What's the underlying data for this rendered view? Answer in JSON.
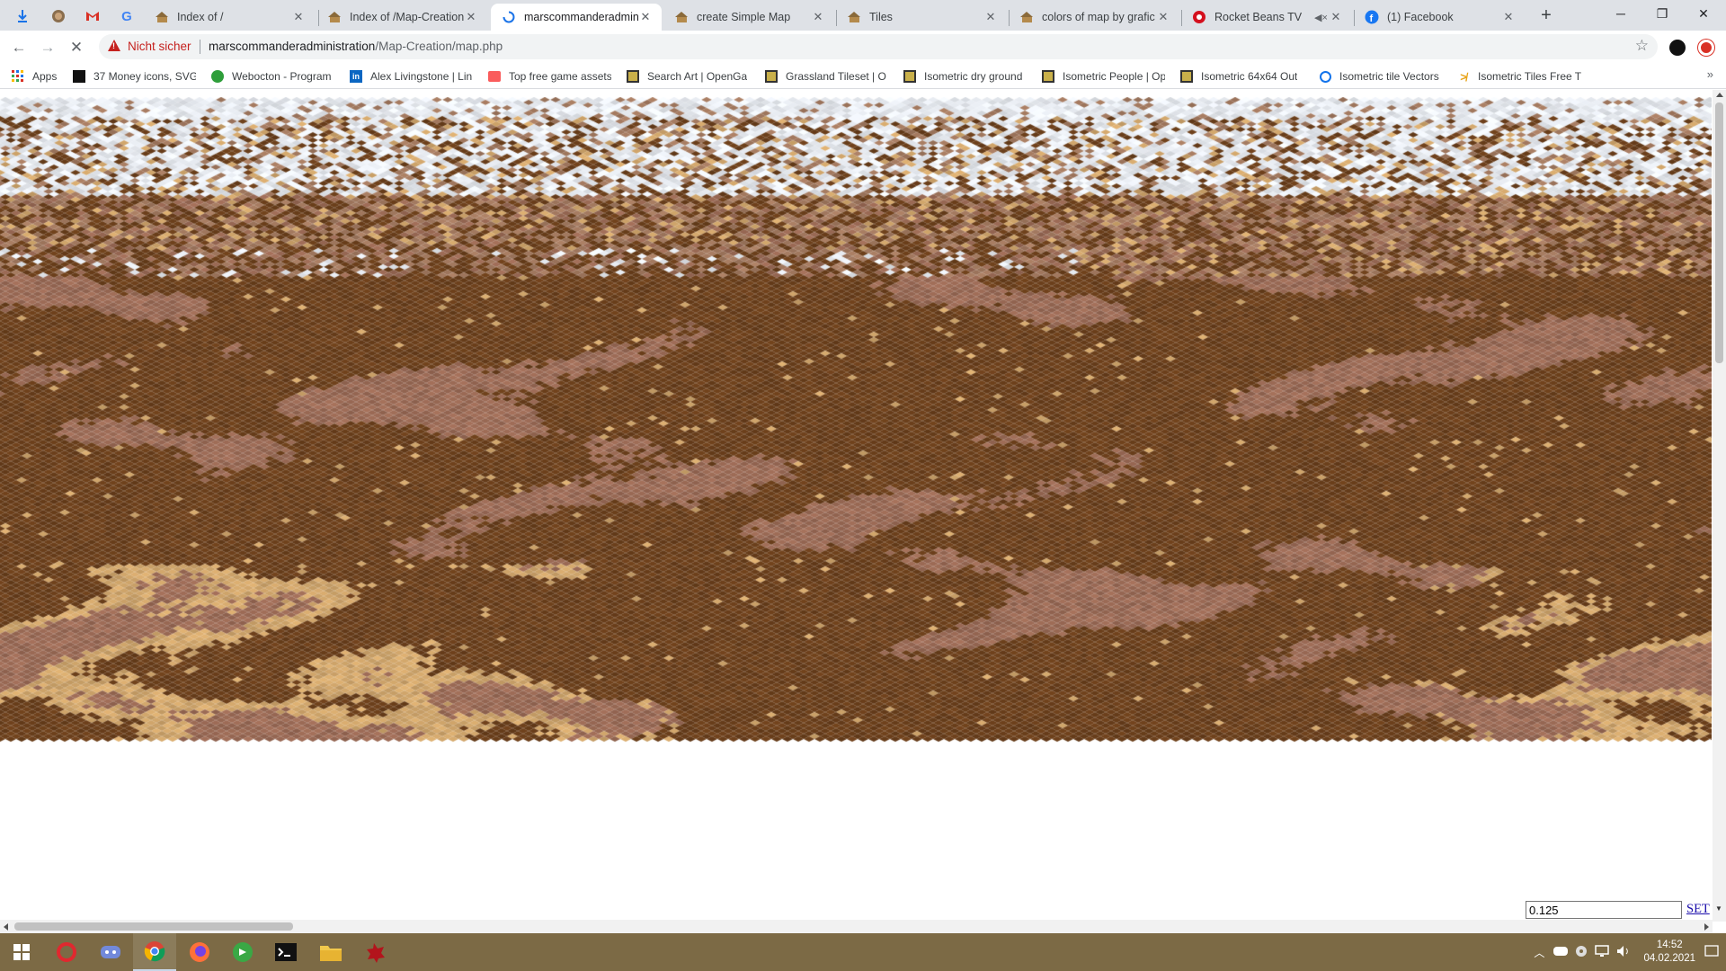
{
  "browser": {
    "tabs": [
      {
        "title": "Index of /",
        "icon": "hut-icon",
        "active": false
      },
      {
        "title": "Index of /Map-Creation",
        "icon": "hut-icon",
        "active": false
      },
      {
        "title": "marscommanderadmini",
        "icon": "loading-spinner-icon",
        "active": true
      },
      {
        "title": "create Simple Map",
        "icon": "hut-icon",
        "active": false
      },
      {
        "title": "Tiles",
        "icon": "hut-icon",
        "active": false
      },
      {
        "title": "colors of map by grafic",
        "icon": "hut-icon",
        "active": false
      },
      {
        "title": "Rocket Beans TV",
        "icon": "rocket-beans-icon",
        "active": false,
        "muted_audio": true
      },
      {
        "title": "(1) Facebook",
        "icon": "facebook-icon",
        "active": false
      }
    ],
    "pinned_icons": [
      "download-icon",
      "face-icon",
      "gmail-icon",
      "google-icon"
    ],
    "security_label": "Nicht sicher",
    "url_host": "marscommanderadministration",
    "url_path": "/Map-Creation/map.php"
  },
  "bookmarks": [
    {
      "label": "Apps",
      "icon": "apps-grid-icon"
    },
    {
      "label": "37 Money icons, SVG",
      "icon": "black-square-icon"
    },
    {
      "label": "Webocton - Program",
      "icon": "green-circle-icon"
    },
    {
      "label": "Alex Livingstone | Lin",
      "icon": "linkedin-icon"
    },
    {
      "label": "Top free game assets",
      "icon": "itch-icon"
    },
    {
      "label": "Search Art | OpenGa",
      "icon": "opengameart-icon"
    },
    {
      "label": "Grassland Tileset | O",
      "icon": "opengameart-icon"
    },
    {
      "label": "Isometric dry ground",
      "icon": "opengameart-icon"
    },
    {
      "label": "Isometric People | Op",
      "icon": "opengameart-icon"
    },
    {
      "label": "Isometric 64x64 Out",
      "icon": "opengameart-icon"
    },
    {
      "label": "Isometric tile Vectors",
      "icon": "freepik-icon"
    },
    {
      "label": "Isometric Tiles Free T",
      "icon": "craftpix-icon"
    }
  ],
  "page": {
    "zoom_value": "0.125",
    "set_label": "SET"
  },
  "map_palette": {
    "dark": "#6b3f1b",
    "medium": "#9b6a55",
    "light": "#d2a76c",
    "snow": "#e8ecf2",
    "rock": "#a47a60"
  },
  "taskbar": {
    "apps": [
      "windows-start-icon",
      "opera-icon",
      "discord-icon",
      "chrome-icon",
      "firefox-icon",
      "green-app-icon",
      "terminal-icon",
      "folder-icon",
      "game-app-icon"
    ],
    "time": "14:52",
    "date": "04.02.2021"
  }
}
